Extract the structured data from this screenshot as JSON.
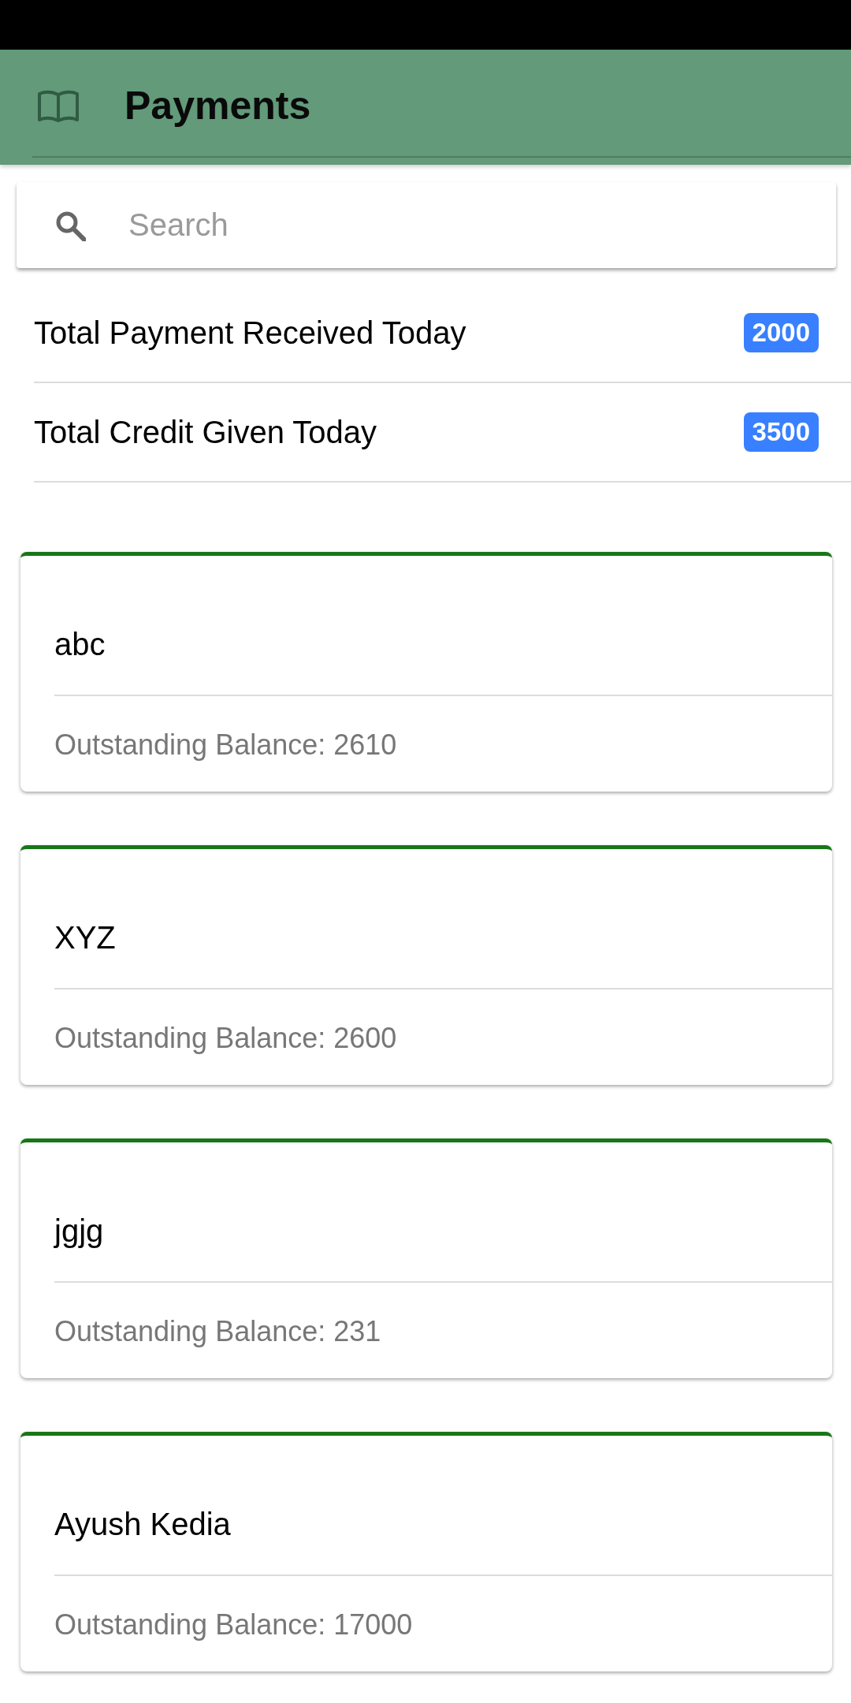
{
  "header": {
    "title": "Payments"
  },
  "search": {
    "placeholder": "Search"
  },
  "totals": [
    {
      "label": "Total Payment Received Today",
      "badge": "2000"
    },
    {
      "label": "Total Credit Given Today",
      "badge": "3500"
    }
  ],
  "customers": [
    {
      "name": "abc",
      "balance": "Outstanding Balance: 2610"
    },
    {
      "name": "XYZ",
      "balance": "Outstanding Balance: 2600"
    },
    {
      "name": "jgjg",
      "balance": "Outstanding Balance: 231"
    },
    {
      "name": "Ayush Kedia",
      "balance": "Outstanding Balance: 17000"
    }
  ]
}
